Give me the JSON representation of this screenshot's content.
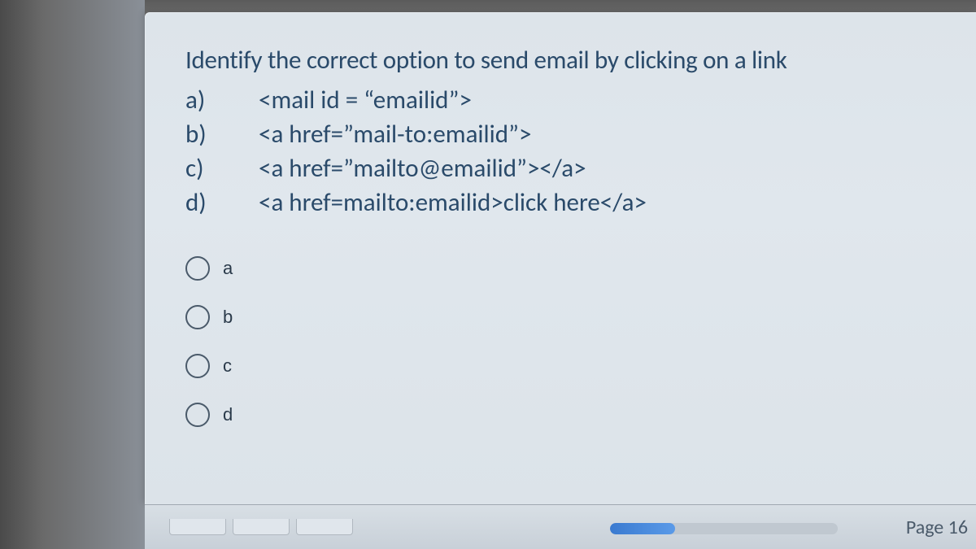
{
  "question": {
    "title": "Identify the correct option to send email  by clicking on a link",
    "options": [
      {
        "letter": "a)",
        "text": "<mail id = “emailid”>"
      },
      {
        "letter": "b)",
        "text": "<a href=”mail-to:emailid”>"
      },
      {
        "letter": "c)",
        "text": "<a href=”mailto@emailid”></a>"
      },
      {
        "letter": "d)",
        "text": "<a href=mailto:emailid>click here</a>"
      }
    ]
  },
  "radios": [
    {
      "label": "a"
    },
    {
      "label": "b"
    },
    {
      "label": "c"
    },
    {
      "label": "d"
    }
  ],
  "footer": {
    "page_label": "Page 16"
  }
}
